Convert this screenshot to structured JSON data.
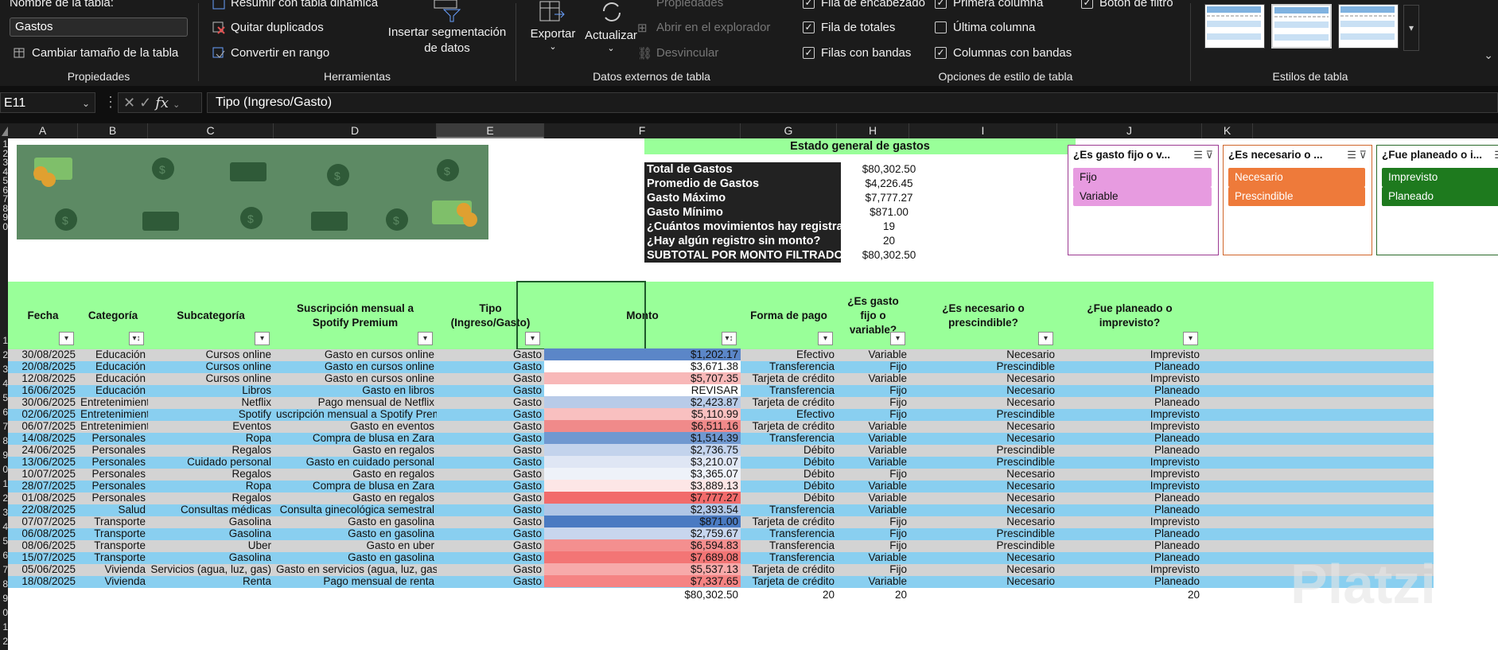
{
  "ribbon": {
    "propiedades": {
      "table_name_label": "Nombre de la tabla:",
      "table_name_value": "Gastos",
      "resize_label": "Cambiar tamaño de la tabla",
      "group_label": "Propiedades"
    },
    "herramientas": {
      "pivot_label": "Resumir con tabla dinámica",
      "dedupe_label": "Quitar duplicados",
      "convert_label": "Convertir en rango",
      "slicer_label_1": "Insertar segmentación",
      "slicer_label_2": "de datos",
      "group_label": "Herramientas"
    },
    "datos_externos": {
      "export_label": "Exportar",
      "refresh_label": "Actualizar",
      "properties_label": "Propiedades",
      "browser_label": "Abrir en el explorador",
      "unlink_label": "Desvincular",
      "group_label": "Datos externos de tabla"
    },
    "opciones_estilo": {
      "header_row": "Fila de encabezado",
      "total_row": "Fila de totales",
      "banded_rows": "Filas con bandas",
      "first_col": "Primera columna",
      "last_col": "Última columna",
      "banded_cols": "Columnas con bandas",
      "filter_btn": "Botón de filtro",
      "header_row_checked": true,
      "total_row_checked": true,
      "banded_rows_checked": true,
      "first_col_checked": true,
      "last_col_checked": false,
      "banded_cols_checked": true,
      "filter_btn_checked": true,
      "group_label": "Opciones de estilo de tabla"
    },
    "estilos": {
      "group_label": "Estilos de tabla"
    }
  },
  "formula_bar": {
    "cell_ref": "E11",
    "fx": "fx",
    "content": "Tipo (Ingreso/Gasto)"
  },
  "columns": [
    "A",
    "B",
    "C",
    "D",
    "E",
    "F",
    "G",
    "H",
    "I",
    "J",
    "K"
  ],
  "row_numbers": [
    "1",
    "2",
    "3",
    "4",
    "5",
    "6",
    "7",
    "8",
    "9",
    "0",
    "1",
    "2",
    "3",
    "4",
    "5",
    "6",
    "7",
    "8",
    "9",
    "0",
    "1",
    "2",
    "3",
    "4",
    "5",
    "6",
    "7",
    "8",
    "9",
    "0",
    "1",
    "2"
  ],
  "summary": {
    "title": "Estado general de gastos",
    "rows": [
      {
        "label": "Total de Gastos",
        "value": "$80,302.50"
      },
      {
        "label": "Promedio de Gastos",
        "value": "$4,226.45"
      },
      {
        "label": "Gasto Máximo",
        "value": "$7,777.27"
      },
      {
        "label": "Gasto Mínimo",
        "value": "$871.00"
      },
      {
        "label": "¿Cuántos movimientos hay registrados?",
        "value": "19"
      },
      {
        "label": "¿Hay algún registro sin monto?",
        "value": "20"
      },
      {
        "label": "SUBTOTAL POR MONTO FILTRADO",
        "value": "$80,302.50"
      }
    ]
  },
  "slicers": [
    {
      "title": "¿Es gasto fijo o v...",
      "items": [
        "Fijo",
        "Variable"
      ],
      "color": "#e79be0",
      "border": "#9c3a92"
    },
    {
      "title": "¿Es necesario o ...",
      "items": [
        "Necesario",
        "Prescindible"
      ],
      "color": "#ee7a3a",
      "border": "#d0652a"
    },
    {
      "title": "¿Fue planeado o i...",
      "items": [
        "Imprevisto",
        "Planeado"
      ],
      "color": "#1e7a1e",
      "border": "#2a6a2a"
    }
  ],
  "table": {
    "headers": [
      "Fecha",
      "Categoría",
      "Subcategoría",
      "Suscripción mensual a Spotify Premium",
      "Tipo (Ingreso/Gasto)",
      "Monto",
      "Forma de pago",
      "¿Es gasto fijo o variable?",
      "¿Es necesario o prescindible?",
      "¿Fue planeado o imprevisto?"
    ],
    "rows": [
      [
        "30/08/2025",
        "Educación",
        "Cursos online",
        "Gasto en cursos online",
        "Gasto",
        "$1,202.17",
        "Efectivo",
        "Variable",
        "Necesario",
        "Imprevisto"
      ],
      [
        "20/08/2025",
        "Educación",
        "Cursos online",
        "Gasto en cursos online",
        "Gasto",
        "$3,671.38",
        "Transferencia",
        "Fijo",
        "Prescindible",
        "Planeado"
      ],
      [
        "12/08/2025",
        "Educación",
        "Cursos online",
        "Gasto en cursos online",
        "Gasto",
        "$5,707.35",
        "Tarjeta de crédito",
        "Variable",
        "Necesario",
        "Imprevisto"
      ],
      [
        "16/06/2025",
        "Educación",
        "Libros",
        "Gasto en libros",
        "Gasto",
        "REVISAR",
        "Transferencia",
        "Fijo",
        "Necesario",
        "Planeado"
      ],
      [
        "30/06/2025",
        "Entretenimiento",
        "Netflix",
        "Pago mensual de Netflix",
        "Gasto",
        "$2,423.87",
        "Tarjeta de crédito",
        "Fijo",
        "Necesario",
        "Planeado"
      ],
      [
        "02/06/2025",
        "Entretenimiento",
        "Spotify",
        "uscripción mensual a Spotify Premium",
        "Gasto",
        "$5,110.99",
        "Efectivo",
        "Fijo",
        "Prescindible",
        "Imprevisto"
      ],
      [
        "06/07/2025",
        "Entretenimiento",
        "Eventos",
        "Gasto en eventos",
        "Gasto",
        "$6,511.16",
        "Tarjeta de crédito",
        "Variable",
        "Necesario",
        "Imprevisto"
      ],
      [
        "14/08/2025",
        "Personales",
        "Ropa",
        "Compra de blusa en Zara",
        "Gasto",
        "$1,514.39",
        "Transferencia",
        "Variable",
        "Necesario",
        "Planeado"
      ],
      [
        "24/06/2025",
        "Personales",
        "Regalos",
        "Gasto en regalos",
        "Gasto",
        "$2,736.75",
        "Débito",
        "Variable",
        "Prescindible",
        "Planeado"
      ],
      [
        "13/06/2025",
        "Personales",
        "Cuidado personal",
        "Gasto en cuidado personal",
        "Gasto",
        "$3,210.07",
        "Débito",
        "Variable",
        "Prescindible",
        "Imprevisto"
      ],
      [
        "10/07/2025",
        "Personales",
        "Regalos",
        "Gasto en regalos",
        "Gasto",
        "$3,365.07",
        "Débito",
        "Fijo",
        "Necesario",
        "Imprevisto"
      ],
      [
        "28/07/2025",
        "Personales",
        "Ropa",
        "Compra de blusa en Zara",
        "Gasto",
        "$3,889.13",
        "Débito",
        "Variable",
        "Necesario",
        "Imprevisto"
      ],
      [
        "01/08/2025",
        "Personales",
        "Regalos",
        "Gasto en regalos",
        "Gasto",
        "$7,777.27",
        "Débito",
        "Variable",
        "Necesario",
        "Planeado"
      ],
      [
        "22/08/2025",
        "Salud",
        "Consultas médicas",
        "Consulta ginecológica semestral",
        "Gasto",
        "$2,393.54",
        "Transferencia",
        "Variable",
        "Necesario",
        "Planeado"
      ],
      [
        "07/07/2025",
        "Transporte",
        "Gasolina",
        "Gasto en gasolina",
        "Gasto",
        "$871.00",
        "Tarjeta de crédito",
        "Fijo",
        "Necesario",
        "Imprevisto"
      ],
      [
        "06/08/2025",
        "Transporte",
        "Gasolina",
        "Gasto en gasolina",
        "Gasto",
        "$2,759.67",
        "Transferencia",
        "Fijo",
        "Prescindible",
        "Planeado"
      ],
      [
        "08/06/2025",
        "Transporte",
        "Uber",
        "Gasto en uber",
        "Gasto",
        "$6,594.83",
        "Transferencia",
        "Fijo",
        "Prescindible",
        "Planeado"
      ],
      [
        "15/07/2025",
        "Transporte",
        "Gasolina",
        "Gasto en gasolina",
        "Gasto",
        "$7,689.08",
        "Transferencia",
        "Variable",
        "Necesario",
        "Planeado"
      ],
      [
        "05/06/2025",
        "Vivienda",
        "Servicios (agua, luz, gas)",
        "Gasto en servicios (agua, luz, gas)",
        "Gasto",
        "$5,537.13",
        "Tarjeta de crédito",
        "Fijo",
        "Necesario",
        "Imprevisto"
      ],
      [
        "18/08/2025",
        "Vivienda",
        "Renta",
        "Pago mensual de renta",
        "Gasto",
        "$7,337.65",
        "Tarjeta de crédito",
        "Variable",
        "Necesario",
        "Planeado"
      ]
    ],
    "monto_colors": [
      "#5b86c8",
      "#ffffff",
      "#f8b8b8",
      "#ffffff",
      "#b8cbe8",
      "#f9c0c0",
      "#f08a8a",
      "#7098d0",
      "#c3d3ec",
      "#dfe6f4",
      "#eef2f9",
      "#fde6e6",
      "#f26b6b",
      "#b0c6e6",
      "#4a7ac2",
      "#c8d6ee",
      "#f48f8f",
      "#f37575",
      "#f7aaaa",
      "#f58383"
    ],
    "totals": {
      "monto": "$80,302.50",
      "forma": "20",
      "fijo": "20",
      "planeado": "20"
    }
  },
  "watermark": "Platzi"
}
